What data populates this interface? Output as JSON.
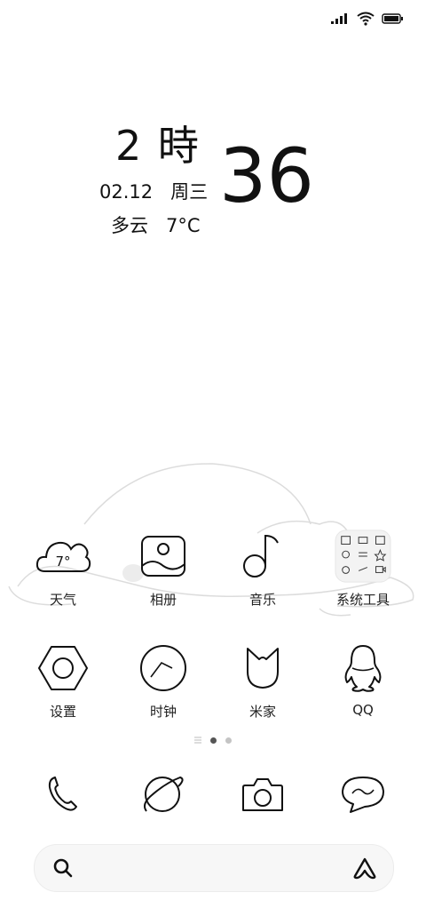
{
  "status_bar": {
    "signal_icon": "signal-icon",
    "wifi_icon": "wifi-icon",
    "battery_icon": "battery-icon"
  },
  "clock": {
    "hour": "2 時",
    "minute": "36",
    "date": "02.12",
    "weekday": "周三",
    "weather": "多云",
    "temperature": "7°C"
  },
  "apps": [
    {
      "label": "天气",
      "icon": "weather-cloud-icon",
      "icon_text": "7°"
    },
    {
      "label": "相册",
      "icon": "gallery-icon"
    },
    {
      "label": "音乐",
      "icon": "music-note-icon"
    },
    {
      "label": "系统工具",
      "icon": "system-tools-folder-icon"
    },
    {
      "label": "设置",
      "icon": "settings-hex-icon"
    },
    {
      "label": "时钟",
      "icon": "clock-icon"
    },
    {
      "label": "米家",
      "icon": "mijia-icon"
    },
    {
      "label": "QQ",
      "icon": "qq-penguin-icon"
    }
  ],
  "page_indicator": {
    "pages": 3,
    "current": 1
  },
  "dock": [
    {
      "icon": "phone-icon"
    },
    {
      "icon": "browser-planet-icon"
    },
    {
      "icon": "camera-icon"
    },
    {
      "icon": "messages-icon"
    }
  ],
  "search_bar": {
    "search_icon": "search-icon",
    "assistant_icon": "assistant-icon"
  },
  "colors": {
    "background": "#ffffff",
    "foreground": "#111111",
    "search_bg": "#f7f7f7"
  }
}
